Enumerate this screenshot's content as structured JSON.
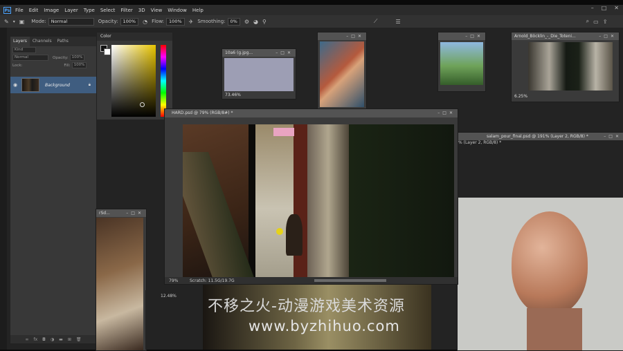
{
  "app": {
    "logo": "Ps"
  },
  "menu": [
    "File",
    "Edit",
    "Image",
    "Layer",
    "Type",
    "Select",
    "Filter",
    "3D",
    "View",
    "Window",
    "Help"
  ],
  "window_controls": [
    "–",
    "□",
    "✕"
  ],
  "options": {
    "mode_label": "Mode:",
    "mode_value": "Normal",
    "opacity_label": "Opacity:",
    "opacity_value": "100%",
    "flow_label": "Flow:",
    "flow_value": "100%",
    "smoothing_label": "Smoothing:",
    "smoothing_value": "0%"
  },
  "layers_panel": {
    "tabs": [
      "Layers",
      "Channels",
      "Paths"
    ],
    "kind": "Kind",
    "blend": "Normal",
    "opacity_label": "Opacity:",
    "opacity_value": "100%",
    "lock_label": "Lock:",
    "fill_label": "Fill:",
    "fill_value": "100%",
    "layer_name": "Background"
  },
  "color_panel": {
    "title": "Color"
  },
  "docs": {
    "doc1": {
      "title": "10a6 (g.jpg...",
      "zoom": "73.46%"
    },
    "doc4": {
      "title": "Arnold_Böcklin_-_Die_Toteni...",
      "zoom": "6.25%"
    },
    "doc5": {
      "title": "salam_pour_final.psd @ 191% (Layer 2, RGB/8) *",
      "sub": "% (Layer 2, RGB/8) *"
    },
    "doc6": {
      "title": "rSd...",
      "zoom": "12.48%"
    },
    "main": {
      "title": "HARD.psd @ 79% (RGB/8#) *",
      "zoom": "79%",
      "scratch": "Scratch: 11.5G/19.7G"
    }
  },
  "watermark": {
    "line1": "不移之火-动漫游戏美术资源",
    "line2": "www.byzhihuo.com"
  }
}
